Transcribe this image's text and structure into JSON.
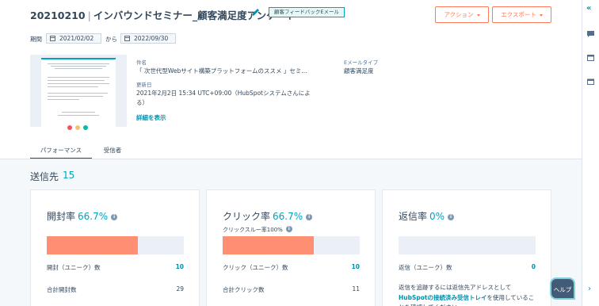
{
  "header": {
    "title_id": "20210210",
    "title_separator": "|",
    "title_name": "インバウンドセミナー_顧客満足度アンケート",
    "badge": "顧客フィードバックEメール",
    "action_button": "アクション",
    "export_button": "エクスポート"
  },
  "period": {
    "label": "期間",
    "from": "2021/02/02",
    "separator": "から",
    "to": "2022/09/30"
  },
  "details": {
    "subject_label": "件名",
    "subject_value": "「 次世代型Webサイト構築プラットフォームのススメ 」セミ...",
    "updated_label": "更新日",
    "updated_value_line1": "2021年2月2日 15:34 UTC+09:00（HubSpotシステムさんによ",
    "updated_value_line2": "る）",
    "email_type_label": "Eメールタイプ",
    "email_type_value": "顧客満足度",
    "show_details_link": "詳細を表示"
  },
  "tabs": [
    "パフォーマンス",
    "受信者"
  ],
  "summary": {
    "sent_label": "送信先",
    "sent_count": "15"
  },
  "cards": [
    {
      "title": "開封率",
      "percent": "66.7%",
      "fill": 0.667,
      "rows": [
        {
          "label": "開封（ユニーク）数",
          "value": "10"
        },
        {
          "label": "合計開封数",
          "value": "29"
        }
      ]
    },
    {
      "title": "クリック率",
      "percent": "66.7%",
      "sub_label": "クリックスルー率100%",
      "fill": 0.667,
      "rows": [
        {
          "label": "クリック（ユニーク）数",
          "value": "10"
        },
        {
          "label": "合計クリック数",
          "value": "11"
        }
      ]
    },
    {
      "title": "返信率",
      "percent": "0%",
      "fill": 0,
      "rows": [
        {
          "label": "返信（ユニーク）数",
          "value": "0"
        }
      ],
      "note_prefix": "返信を追跡するには返信先アドレスとして",
      "note_link": "HubSpotの接続済み受信トレイ",
      "note_suffix": "を使用していることを確認してください。"
    }
  ],
  "help_button": "ヘルプ",
  "colors": {
    "accent": "#00a4bd",
    "bar_fill": "#ff8f73",
    "button": "#ff7a59",
    "link": "#0091ae"
  },
  "icons": {
    "edit": "pencil-icon",
    "calendar": "calendar-icon",
    "info": "info-icon",
    "collapse": "double-chevron-left-icon",
    "rail_chat": "chat-icon",
    "rail_window": "window-icon",
    "rail_calendar": "calendar-icon",
    "rail_next": "chevron-right-icon"
  }
}
